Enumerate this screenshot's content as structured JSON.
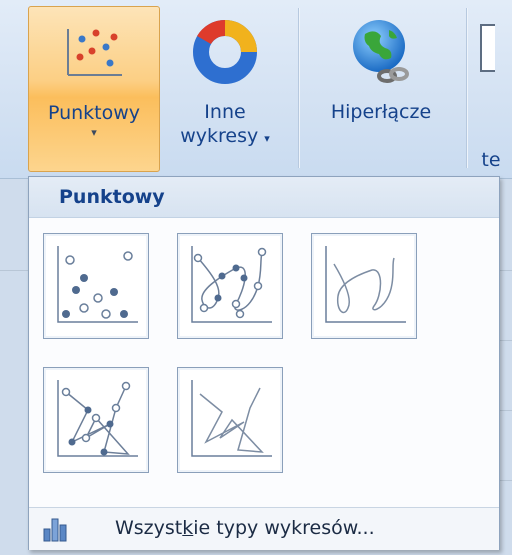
{
  "ribbon": {
    "buttons": [
      {
        "label": "Punktowy",
        "has_dropdown": true,
        "active": true,
        "icon": "scatter-chart-icon"
      },
      {
        "label_line1": "Inne",
        "label_line2": "wykresy",
        "has_dropdown": true,
        "icon": "donut-chart-icon"
      },
      {
        "label": "Hiperłącze",
        "icon": "globe-link-icon"
      },
      {
        "label": "te",
        "icon": "textbox-icon"
      }
    ],
    "dropdown_arrow": "▾"
  },
  "gallery": {
    "title": "Punktowy",
    "items": [
      {
        "name": "scatter-markers-only"
      },
      {
        "name": "scatter-smooth-lines-markers"
      },
      {
        "name": "scatter-smooth-lines"
      },
      {
        "name": "scatter-straight-lines-markers"
      },
      {
        "name": "scatter-straight-lines"
      }
    ],
    "footer": {
      "text_before": "Wszyst",
      "accel": "k",
      "text_after": "ie typy wykresów...",
      "icon": "all-chart-types-icon"
    }
  },
  "colors": {
    "accent_text": "#15428b",
    "active_button": "#fbbe5c",
    "marker_fill": "#4f6a8f"
  }
}
